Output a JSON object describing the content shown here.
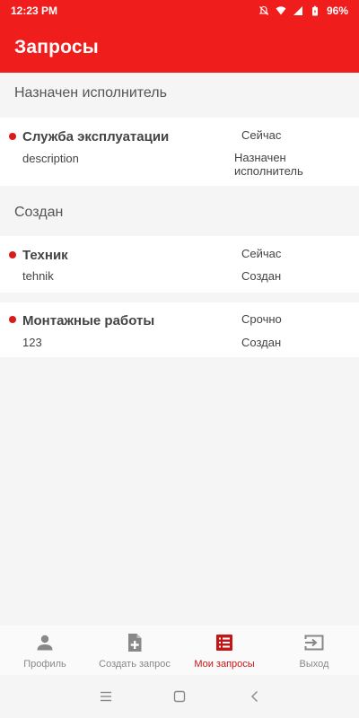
{
  "status_bar": {
    "time": "12:23 PM",
    "battery": "96%"
  },
  "header": {
    "title": "Запросы"
  },
  "sections": [
    {
      "title": "Назначен исполнитель",
      "items": [
        {
          "title": "Служба эксплуатации",
          "description": "description",
          "time": "Сейчас",
          "status": "Назначен исполнитель"
        }
      ]
    },
    {
      "title": "Создан",
      "items": [
        {
          "title": "Техник",
          "description": "tehnik",
          "time": "Сейчас",
          "status": "Создан"
        },
        {
          "title": "Монтажные работы",
          "description": "123",
          "time": "Срочно",
          "status": "Создан"
        }
      ]
    }
  ],
  "bottom_nav": {
    "items": [
      {
        "label": "Профиль",
        "icon": "person-icon"
      },
      {
        "label": "Создать запрос",
        "icon": "add-document-icon"
      },
      {
        "label": "Мои запросы",
        "icon": "list-icon"
      },
      {
        "label": "Выход",
        "icon": "logout-icon"
      }
    ],
    "active_index": 2
  },
  "colors": {
    "primary": "#f01d1d",
    "active": "#c71414",
    "dot": "#d91b1b",
    "inactive": "#888888"
  }
}
